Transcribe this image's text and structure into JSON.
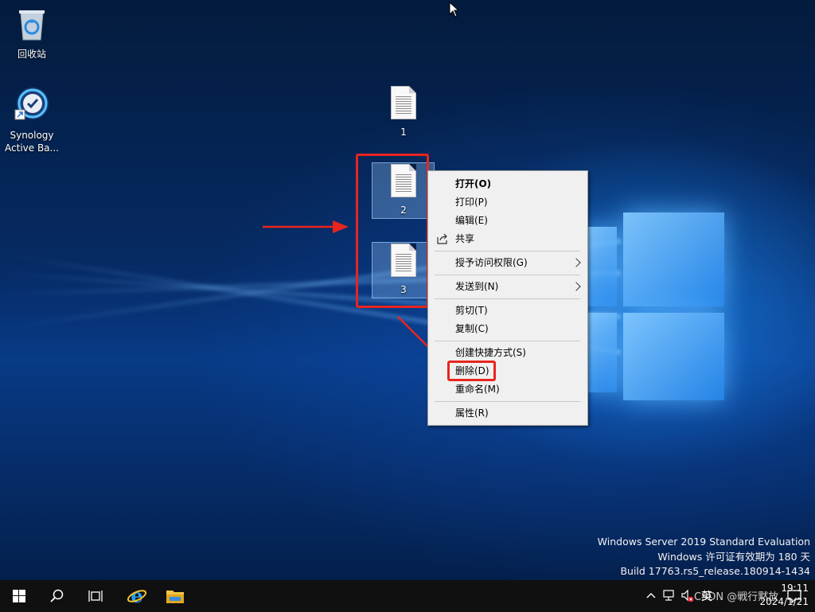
{
  "desktop": {
    "icons": [
      {
        "label": "回收站"
      },
      {
        "label": "Synology\nActive Ba..."
      },
      {
        "label": "1"
      },
      {
        "label": "2"
      },
      {
        "label": "3"
      }
    ]
  },
  "context_menu": {
    "items": [
      {
        "label": "打开(O)",
        "bold": true
      },
      {
        "label": "打印(P)"
      },
      {
        "label": "编辑(E)"
      },
      {
        "label": "共享",
        "icon": "share-icon"
      },
      {
        "label": "授予访问权限(G)",
        "submenu": true
      },
      {
        "label": "发送到(N)",
        "submenu": true
      },
      {
        "label": "剪切(T)"
      },
      {
        "label": "复制(C)"
      },
      {
        "label": "创建快捷方式(S)"
      },
      {
        "label": "删除(D)",
        "highlighted": true
      },
      {
        "label": "重命名(M)"
      },
      {
        "label": "属性(R)"
      }
    ]
  },
  "watermark": {
    "line1": "Windows Server 2019 Standard Evaluation",
    "line2": "Windows 许可证有效期为 180 天",
    "line3": "Build 17763.rs5_release.180914-1434"
  },
  "taskbar": {
    "buttons": [
      "windows-start-icon",
      "search-icon",
      "task-view-icon",
      "internet-explorer-icon",
      "file-explorer-icon"
    ],
    "tray": {
      "time": "19:11",
      "date": "2024/1/21",
      "ime": "英",
      "overlay_text": "CSDN @戦行黙放"
    }
  },
  "colors": {
    "accent_red": "#e8251f",
    "menu_bg": "#f0f0f0",
    "taskbar_bg": "#101010"
  }
}
